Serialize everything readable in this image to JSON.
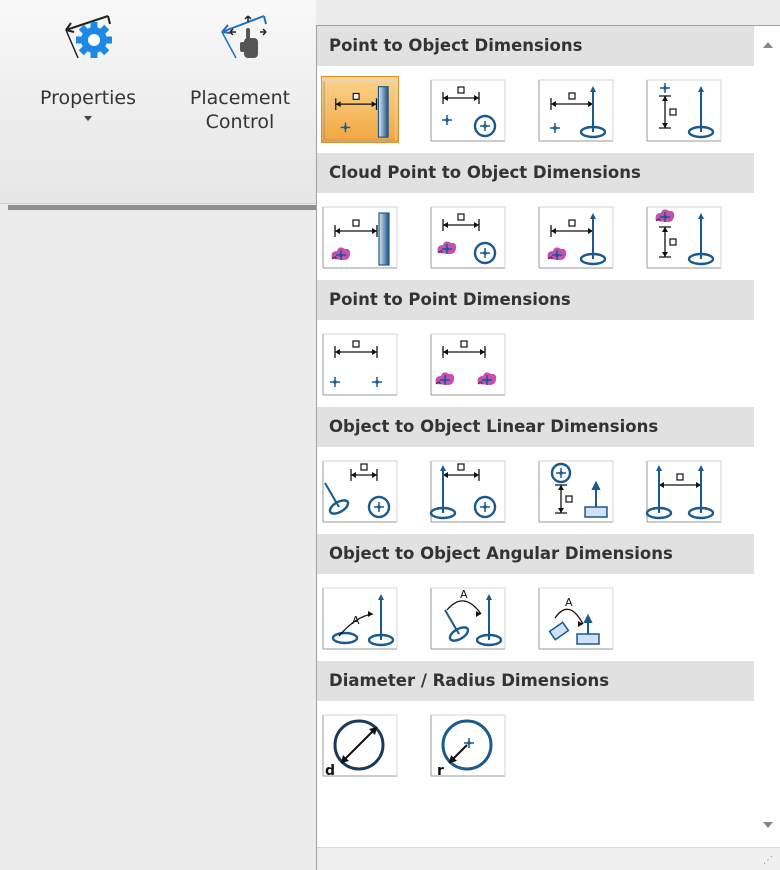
{
  "ribbon": {
    "properties_label": "Properties",
    "placement_line1": "Placement",
    "placement_line2": "Control"
  },
  "colors": {
    "selected_tile": "#f3a540",
    "cloud_point": "#c64fb3",
    "shape_blue": "#1a5a8e"
  },
  "groups": [
    {
      "title": "Point to Object Dimensions",
      "items": [
        "point-to-plane-icon",
        "point-to-circle-icon",
        "point-to-cylinder-icon",
        "point-to-cylinder-vertical-icon"
      ],
      "selected_index": 0
    },
    {
      "title": "Cloud Point to Object Dimensions",
      "items": [
        "cloud-point-to-plane-icon",
        "cloud-point-to-circle-icon",
        "cloud-point-to-cylinder-icon",
        "cloud-point-to-cylinder-vertical-icon"
      ]
    },
    {
      "title": "Point to Point Dimensions",
      "items": [
        "point-to-point-icon",
        "cloud-point-to-cloud-point-icon"
      ]
    },
    {
      "title": "Object to Object Linear Dimensions",
      "items": [
        "cylinder-to-circle-linear-icon",
        "cylinder-to-circle-linear-2-icon",
        "sphere-to-plane-linear-icon",
        "cylinder-to-cylinder-linear-icon"
      ]
    },
    {
      "title": "Object to Object Angular Dimensions",
      "items": [
        "circle-to-cylinder-angular-icon",
        "cylinder-to-cylinder-angular-icon",
        "cylinder-to-plane-angular-icon"
      ]
    },
    {
      "title": "Diameter / Radius Dimensions",
      "items": [
        "diameter-icon",
        "radius-icon"
      ]
    }
  ]
}
